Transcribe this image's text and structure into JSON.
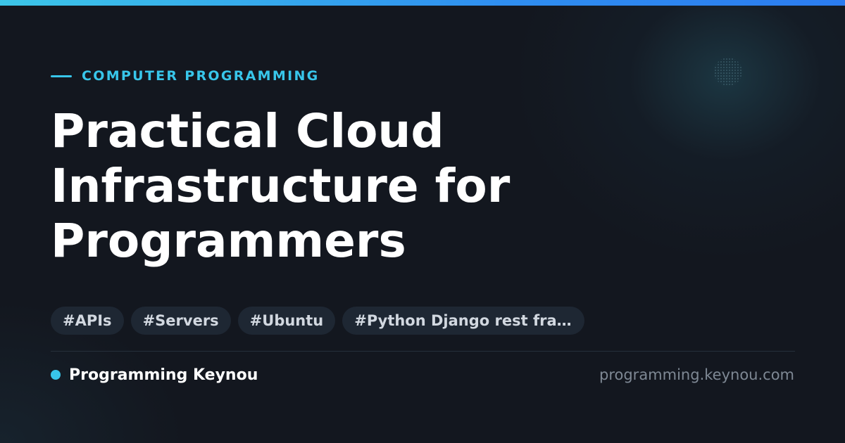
{
  "colors": {
    "background": "#13171f",
    "accent": "#38c6ea",
    "top_bar_end": "#2b7cf0",
    "tag_background": "#1e2733",
    "tag_text": "#d2d8e0",
    "title_text": "#ffffff",
    "muted_text": "#7e8894"
  },
  "category": {
    "label": "COMPUTER PROGRAMMING"
  },
  "title": {
    "line1": "Practical Cloud",
    "line2": "Infrastructure for",
    "line3": "Programmers"
  },
  "tags": [
    "#APIs",
    "#Servers",
    "#Ubuntu",
    "#Python Django rest fram…"
  ],
  "footer": {
    "brand_name": "Programming Keynou",
    "domain": "programming.keynou.com"
  }
}
